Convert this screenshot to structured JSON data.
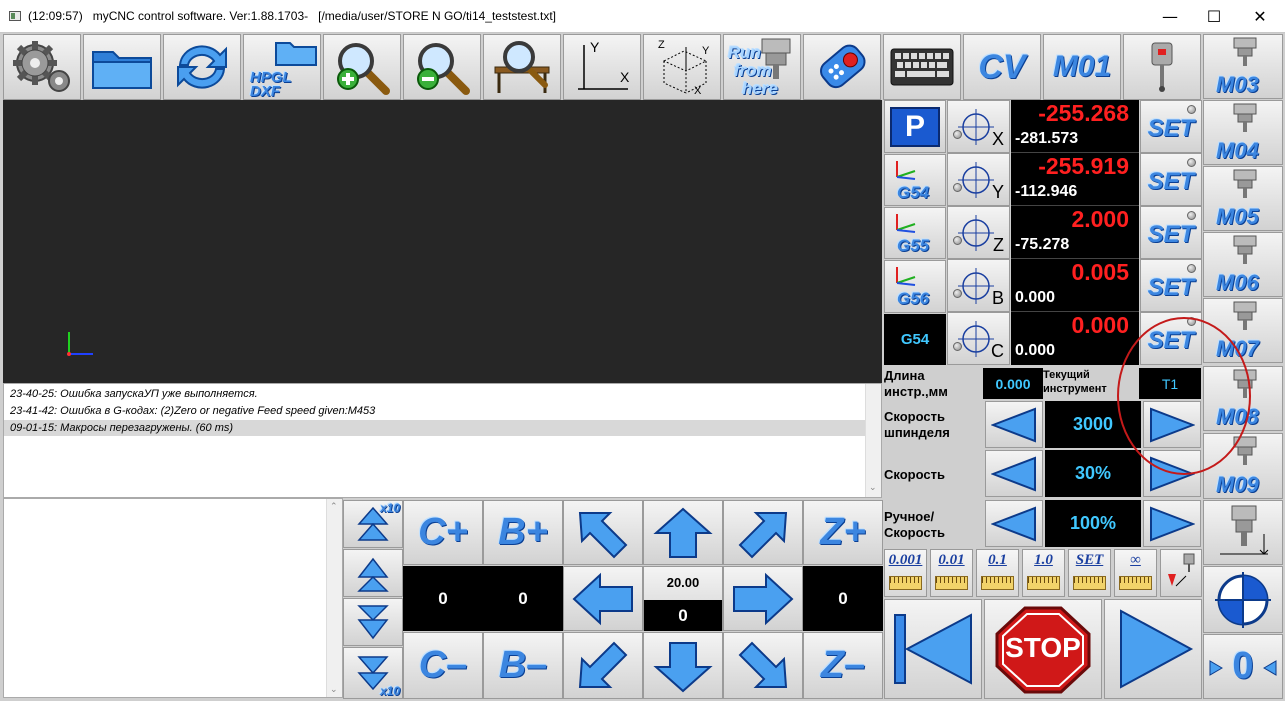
{
  "window": {
    "title": "(12:09:57)   myCNC control software. Ver:1.88.1703-   [/media/user/STORE N GO/ti14_teststest.txt]",
    "minimize": "—",
    "maximize": "☐",
    "close": "✕"
  },
  "toolbar": {
    "hpgl_line1": "HPGL",
    "hpgl_line2": "DXF",
    "axes_y": "Y",
    "axes_x": "X",
    "iso_z": "Z",
    "iso_y": "Y",
    "iso_x": "X",
    "run_line1": "Run",
    "run_line2": "from",
    "run_line3": "here",
    "cv": "CV",
    "m01": "M01"
  },
  "right_mcodes": [
    "M03",
    "M04",
    "M05",
    "M06",
    "M07",
    "M08",
    "M09"
  ],
  "coords": {
    "p_label": "P",
    "g54": "G54",
    "g55": "G55",
    "g56": "G56",
    "active_cs": "G54",
    "set_label": "SET",
    "axes": [
      {
        "axis": "X",
        "machine": "-255.268",
        "work": "-281.573"
      },
      {
        "axis": "Y",
        "machine": "-255.919",
        "work": "-112.946"
      },
      {
        "axis": "Z",
        "machine": "2.000",
        "work": "-75.278"
      },
      {
        "axis": "B",
        "machine": "0.005",
        "work": "0.000"
      },
      {
        "axis": "C",
        "machine": "0.000",
        "work": "0.000"
      }
    ]
  },
  "tool_info": {
    "length_label_1": "Длина",
    "length_label_2": "инстр.,мм",
    "length_value": "0.000",
    "current_label_1": "Текущий",
    "current_label_2": "инструмент",
    "current_value": "T1"
  },
  "overrides": {
    "spindle_label_1": "Скорость",
    "spindle_label_2": "шпинделя",
    "spindle_value": "3000",
    "speed_label": "Скорость",
    "speed_value": "30%",
    "manual_label_1": "Ручное/",
    "manual_label_2": "Скорость",
    "manual_value": "100%"
  },
  "steps": [
    "0.001",
    "0.01",
    "0.1",
    "1.0",
    "SET",
    "∞"
  ],
  "messages": [
    "23-40-25: Ошибка запускаУП уже выполняется.",
    "23-41-42: Ошибка в G-кодах: (2)Zero or negative Feed speed given:M453",
    "09-01-15: Макросы перезагружены. (60 ms)"
  ],
  "jog": {
    "x10": "x10",
    "c_plus": "C+",
    "b_plus": "B+",
    "z_plus": "Z+",
    "c_minus": "C–",
    "b_minus": "B–",
    "z_minus": "Z–",
    "c_value": "0",
    "b_value": "0",
    "feed_value": "20.00",
    "xy_value": "0",
    "z_value": "0"
  },
  "controls": {
    "stop": "STOP",
    "zero_label": "0"
  },
  "colors": {
    "dro_red": "#ff2020",
    "value_cyan": "#40c8ff",
    "accent_blue": "#3c86e0",
    "viewport_bg": "#262626"
  }
}
